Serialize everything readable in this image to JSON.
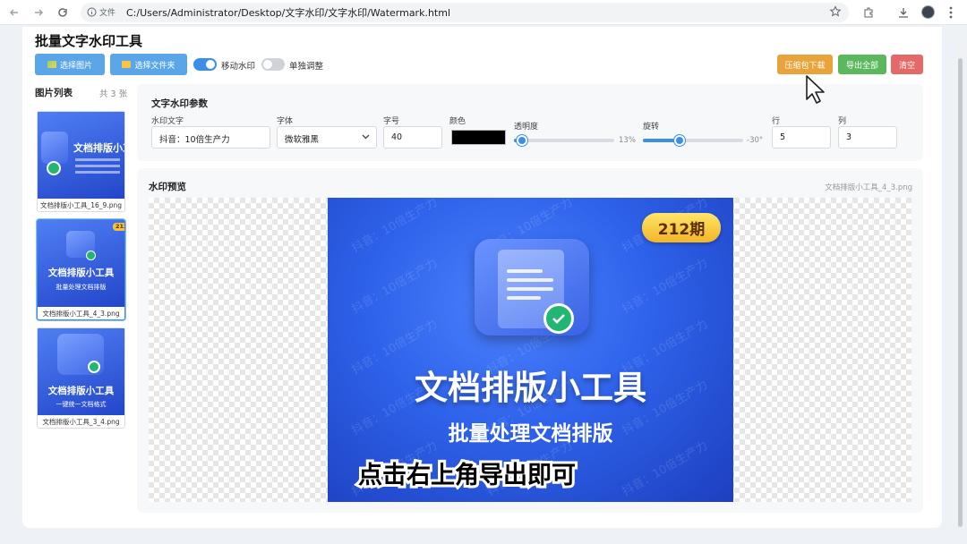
{
  "browser": {
    "security_label": "文件",
    "url": "C:/Users/Administrator/Desktop/文字水印/文字水印/Watermark.html"
  },
  "app": {
    "title": "批量文字水印工具",
    "buttons": {
      "select_images": "选择图片",
      "select_folder": "选择文件夹",
      "zip_download": "压缩包下载",
      "export_all": "导出全部",
      "clear": "清空"
    },
    "toggles": {
      "move_watermark": {
        "label": "移动水印",
        "on": true
      },
      "single_adjust": {
        "label": "单独调整",
        "on": false
      }
    }
  },
  "sidebar": {
    "title": "图片列表",
    "count": "共 3 张",
    "items": [
      {
        "filename": "文档排版小工具_16_9.png",
        "thumb_title": "文档排版小工",
        "active": false
      },
      {
        "filename": "文档排版小工具_4_3.png",
        "thumb_title": "文档排版小工具",
        "thumb_sub": "批量处理文档排版",
        "badge": "212",
        "active": true
      },
      {
        "filename": "文档排版小工具_3_4.png",
        "thumb_title": "文档排版小工具",
        "thumb_sub": "一键统一文档格式",
        "active": false
      }
    ]
  },
  "params": {
    "title": "文字水印参数",
    "text": {
      "label": "水印文字",
      "value": "抖音：10倍生产力"
    },
    "font": {
      "label": "字体",
      "value": "微软雅黑"
    },
    "size": {
      "label": "字号",
      "value": "40"
    },
    "color": {
      "label": "颜色",
      "value": "#000000"
    },
    "opacity": {
      "label": "透明度",
      "value": "13%",
      "fraction": 0.13
    },
    "rotation": {
      "label": "旋转",
      "value": "-30°",
      "fraction": 0.42
    },
    "rows": {
      "label": "行",
      "value": "5"
    },
    "cols": {
      "label": "列",
      "value": "3"
    }
  },
  "preview": {
    "title": "水印预览",
    "filename": "文档排版小工具_4_3.png",
    "image": {
      "badge": "212期",
      "title": "文档排版小工具",
      "subtitle": "批量处理文档排版",
      "overlay_text": "点击右上角导出即可",
      "watermark": "抖音：10倍生产力"
    }
  },
  "colors": {
    "primary": "#5aa6e8",
    "zip_button": "#e8a33b",
    "export_button": "#5cb85c",
    "clear_button": "#e46a6a",
    "toggle_on": "#3b8eea"
  }
}
